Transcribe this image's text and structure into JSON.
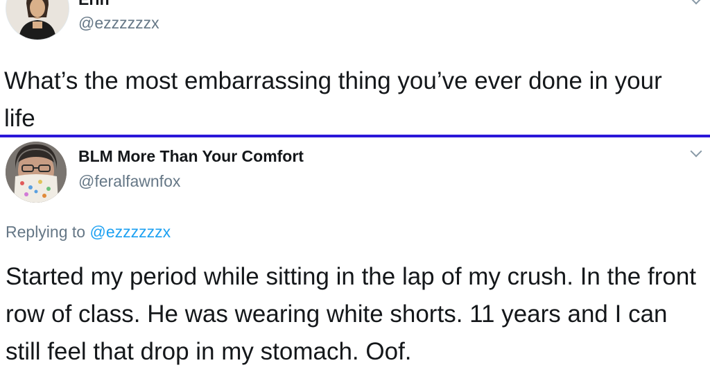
{
  "tweet_top": {
    "display_name": "Erin",
    "handle": "@ezzzzzzx",
    "text": "What’s the most embarrassing thing you’ve ever done in your life"
  },
  "tweet_bottom": {
    "display_name": "BLM More Than Your Comfort",
    "handle": "@feralfawnfox",
    "replying_prefix": "Replying to",
    "replying_mention": "@ezzzzzzx",
    "text": "Started my period while sitting in the lap of my crush. In the front row of class. He was wearing white shorts. 11 years and I can still feel that drop in my stomach. Oof."
  },
  "colors": {
    "divider": "#2b17d9",
    "link": "#1da1f2",
    "secondary_text": "#657786"
  },
  "icons": [
    "chevron-down-icon"
  ]
}
